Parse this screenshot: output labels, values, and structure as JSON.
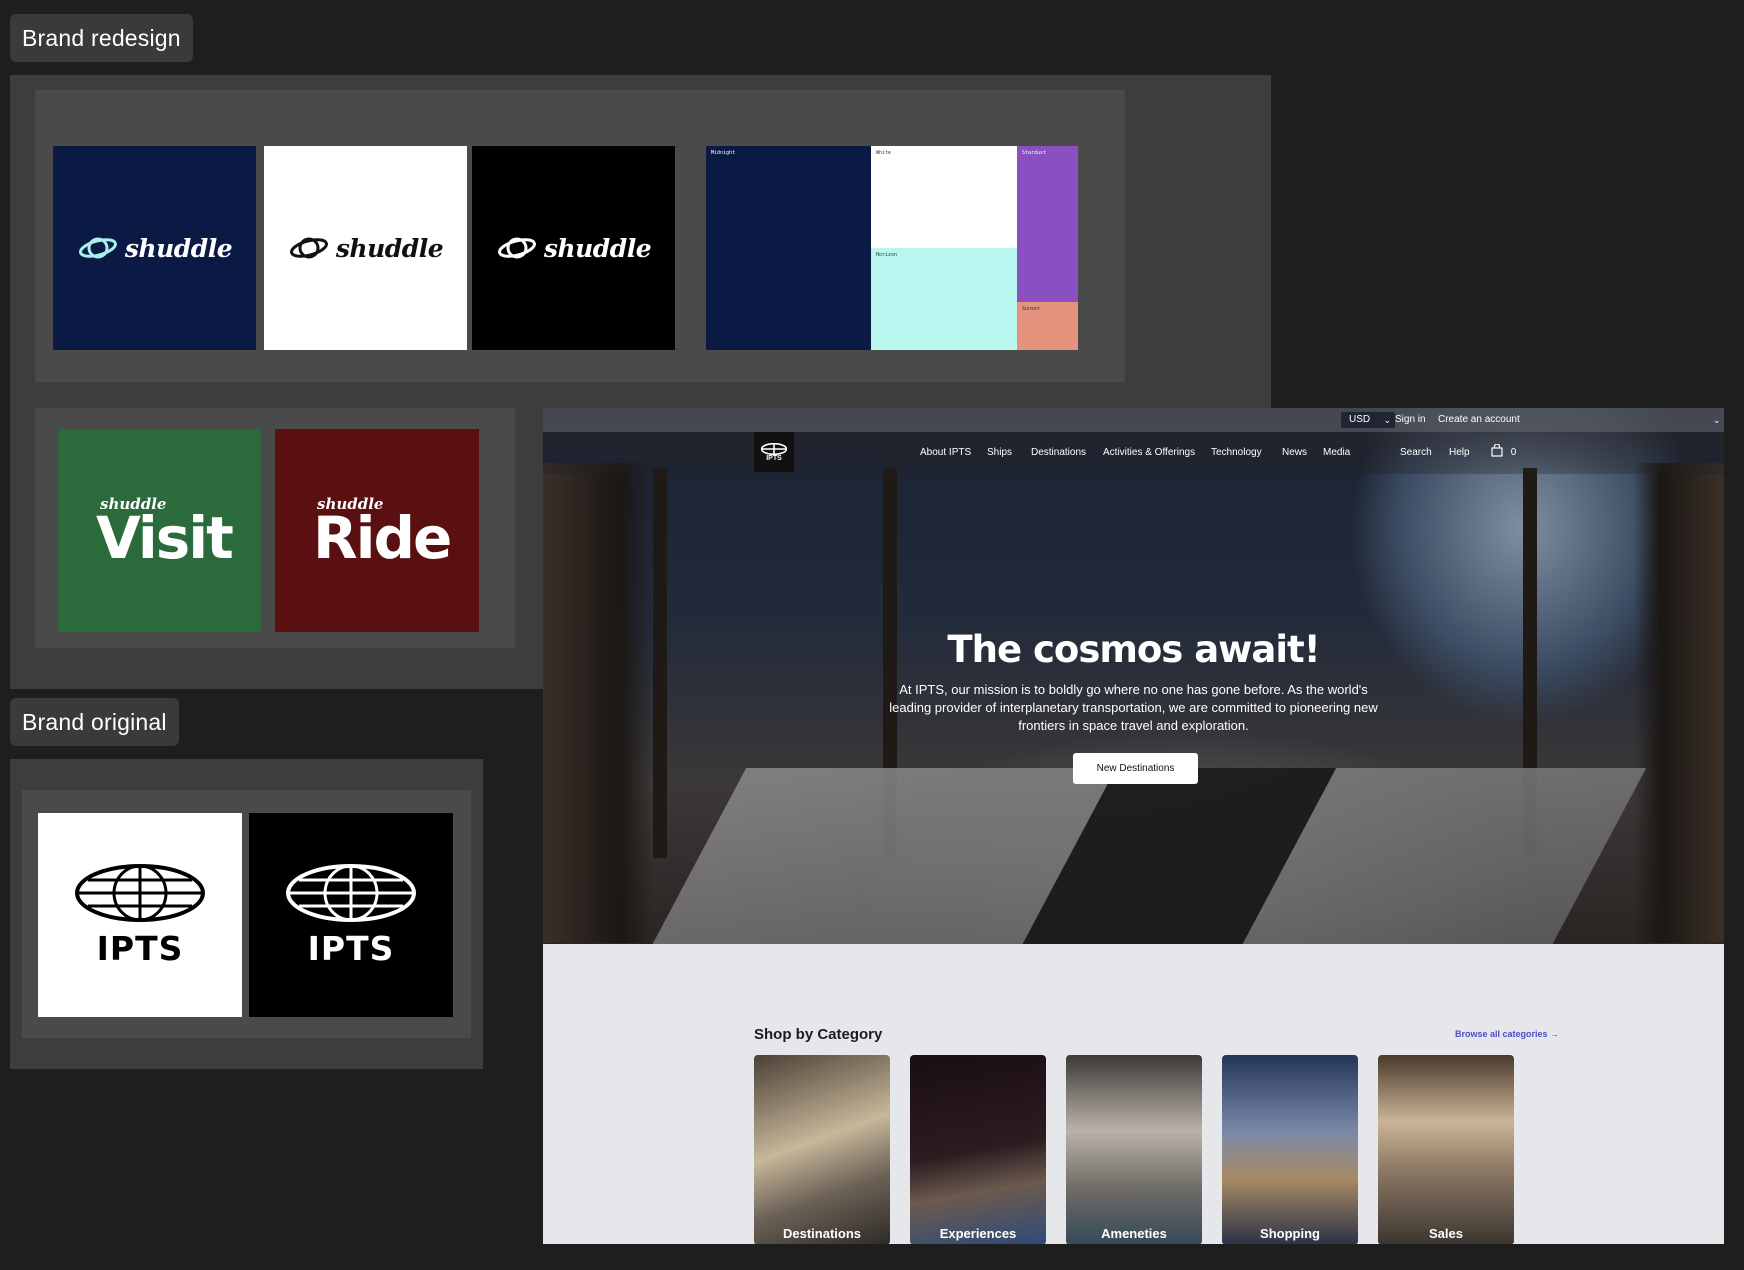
{
  "sections": {
    "redesign_label": "Brand redesign",
    "original_label": "Brand original"
  },
  "shuddle": {
    "wordmark": "shuddle",
    "logo_variants": [
      {
        "bg": "#0a1a44",
        "fg": "#ffffff",
        "planet": "#a8f0ee"
      },
      {
        "bg": "#ffffff",
        "fg": "#111111",
        "planet": "#111111"
      },
      {
        "bg": "#000000",
        "fg": "#ffffff",
        "planet": "#ffffff"
      }
    ],
    "palette": {
      "midnight": {
        "name": "Midnight",
        "color": "#0a1a44"
      },
      "white": {
        "name": "White",
        "color": "#ffffff"
      },
      "stardust": {
        "name": "Stardust",
        "color": "#8a4fc0"
      },
      "horizon": {
        "name": "Horizon",
        "color": "#b7f7ef"
      },
      "sunset": {
        "name": "Sunset",
        "color": "#e5937c"
      }
    },
    "sub_brands": [
      {
        "small": "shuddle",
        "big": "Visit",
        "bg": "#2b6a3a"
      },
      {
        "small": "shuddle",
        "big": "Ride",
        "bg": "#5a0f10"
      }
    ]
  },
  "ipts_logos": {
    "wordmark": "IPTS",
    "variants": [
      {
        "bg": "#ffffff",
        "fg": "#000000"
      },
      {
        "bg": "#000000",
        "fg": "#ffffff"
      }
    ]
  },
  "website": {
    "topbar": {
      "currency": "USD",
      "sign_in": "Sign in",
      "create_account": "Create an account"
    },
    "nav": {
      "logo_text": "IPTS",
      "links": [
        "About IPTS",
        "Ships",
        "Destinations",
        "Activities & Offerings",
        "Technology",
        "News",
        "Media"
      ],
      "search": "Search",
      "help": "Help",
      "cart_count": "0"
    },
    "hero": {
      "title": "The cosmos await!",
      "text": "At IPTS, our mission is to boldly go where no one has gone before. As the world's leading provider of interplanetary transportation, we are committed to pioneering new frontiers in space travel and exploration.",
      "button": "New Destinations"
    },
    "shop": {
      "title": "Shop by Category",
      "browse_link": "Browse all categories →",
      "categories": [
        "Destinations",
        "Experiences",
        "Ameneties",
        "Shopping",
        "Sales"
      ]
    }
  }
}
